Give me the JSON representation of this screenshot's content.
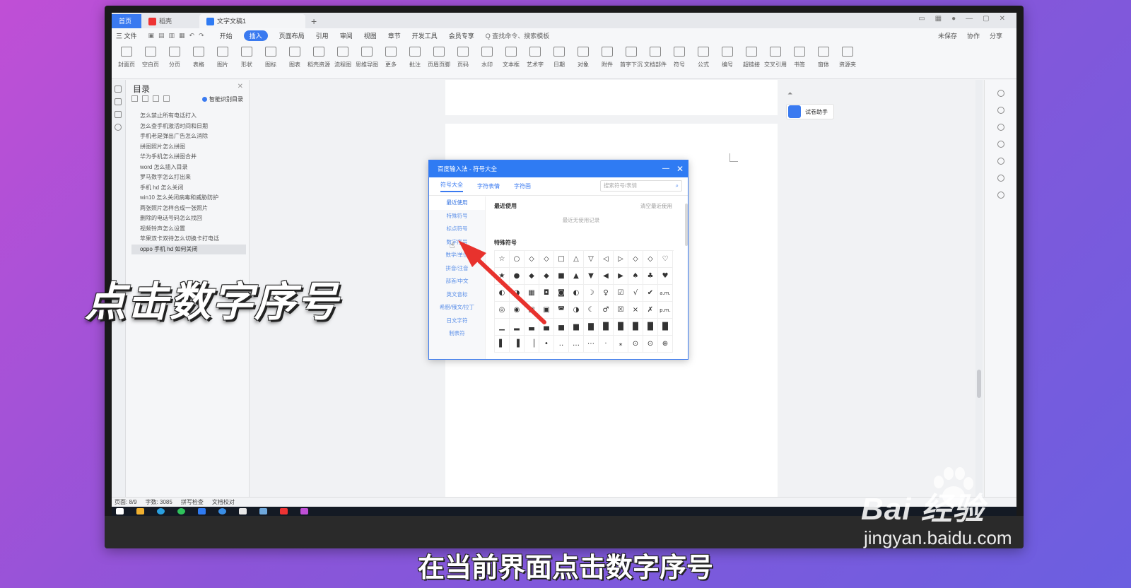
{
  "tabs": [
    {
      "label": "首页"
    },
    {
      "label": "稻壳"
    },
    {
      "label": "文字文稿1"
    }
  ],
  "menu": {
    "file": "三 文件",
    "items": [
      "开始",
      "插入",
      "页面布局",
      "引用",
      "审阅",
      "视图",
      "章节",
      "开发工具",
      "会员专享"
    ],
    "active": "插入",
    "search": "Q 查找命令、搜索模板",
    "right": [
      "未保存",
      "协作",
      "分享"
    ]
  },
  "ribbon": [
    "封面页",
    "空白页",
    "分页",
    "表格",
    "图片",
    "形状",
    "图标",
    "图表",
    "稻壳资源",
    "流程图",
    "思维导图",
    "更多",
    "批注",
    "页眉页脚",
    "页码",
    "水印",
    "文本框",
    "艺术字",
    "日期",
    "对象",
    "附件",
    "首字下沉",
    "文档部件",
    "符号",
    "公式",
    "编号",
    "超链接",
    "交叉引用",
    "书签",
    "窗体",
    "资源夹"
  ],
  "toc": {
    "title": "目录",
    "smart": "智能识别目录",
    "items": [
      "怎么禁止所有电话打入",
      "怎么查手机激活时间和日期",
      "手机老是弹出广告怎么消除",
      "拼图照片怎么拼图",
      "华为手机怎么拼图合并",
      "word 怎么插入目录",
      "罗马数字怎么打出来",
      "手机 hd 怎么关闭",
      "win10 怎么关闭病毒和威胁防护",
      "两张照片怎样合成一张照片",
      "删除的电话号码怎么找回",
      "视频铃声怎么设置",
      "苹果双卡双待怎么切换卡打电话",
      "oppo 手机 hd 如何关闭"
    ],
    "selected": 13
  },
  "assistant": {
    "label": "试卷助手"
  },
  "statusbar": {
    "page": "页面: 8/9",
    "words": "字数: 3085",
    "spell": "拼写检查",
    "proof": "文档校对"
  },
  "dialog": {
    "title": "百度输入法 - 符号大全",
    "tabs": [
      "符号大全",
      "字符表情",
      "字符画"
    ],
    "search_placeholder": "搜索符号/表情",
    "categories": [
      "最近使用",
      "特殊符号",
      "标点符号",
      "数字序号",
      "数学/单位",
      "拼音/注音",
      "部首/中文",
      "英文音标",
      "希腊/俄文/拉丁",
      "日文字符",
      "制表符"
    ],
    "selected_category": 0,
    "recent_header": "最近使用",
    "clear_recent": "清空最近使用",
    "recent_empty": "最近无使用记录",
    "special_header": "特殊符号",
    "symbols": [
      "☆",
      "○",
      "◇",
      "◇",
      "□",
      "△",
      "▽",
      "◁",
      "▷",
      "◇",
      "◇",
      "♡",
      "★",
      "●",
      "◆",
      "◆",
      "■",
      "▲",
      "▼",
      "◀",
      "▶",
      "♠",
      "♣",
      "♥",
      "◐",
      "◑",
      "▦",
      "◘",
      "◙",
      "◐",
      "☽",
      "♀",
      "☑",
      "√",
      "✔",
      "a.m.",
      "◎",
      "◉",
      "▣",
      "▣",
      "◚",
      "◑",
      "☾",
      "♂",
      "☒",
      "×",
      "✗",
      "p.m.",
      "▁",
      "▂",
      "▃",
      "▄",
      "▅",
      "▆",
      "▇",
      "█",
      "█",
      "█",
      "█",
      "█",
      "▌",
      "▐",
      "▕",
      "•",
      "‥",
      "…",
      "⋯",
      "·",
      "⁎",
      "⊙",
      "⊙",
      "⊕"
    ]
  },
  "overlay": {
    "title": "点击数字序号",
    "caption": "在当前界面点击数字序号"
  },
  "watermark": {
    "logo": "Bai 经验",
    "url": "jingyan.baidu.com"
  },
  "colors": {
    "accent": "#2f7bf3",
    "arrow": "#e8322d"
  }
}
